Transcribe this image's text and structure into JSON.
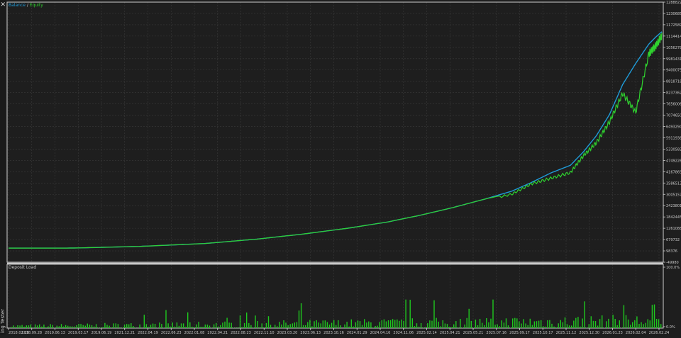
{
  "window": {
    "close_glyph": "✕",
    "side_label": "ing Tester"
  },
  "legend": {
    "balance": "Balance",
    "sep": " / ",
    "equity": "Equity"
  },
  "colors": {
    "background": "#1e1e1e",
    "grid": "#3a3a3a",
    "frame": "#cfcfcf",
    "balance": "#1f9bd8",
    "equity": "#2fd12f",
    "load_bars": "#1ec81e",
    "axis_text": "#c8c8c8"
  },
  "chart_data": [
    {
      "type": "line",
      "series": [
        {
          "name": "Balance",
          "x": [
            0,
            0.1,
            0.2,
            0.3,
            0.38,
            0.45,
            0.52,
            0.58,
            0.63,
            0.68,
            0.73,
            0.77,
            0.8,
            0.83,
            0.86,
            0.88,
            0.9,
            0.92,
            0.94,
            0.96,
            0.98,
            0.99,
            1.0
          ],
          "y": [
            92000,
            96000,
            180000,
            330000,
            560000,
            820000,
            1130000,
            1450000,
            1800000,
            2200000,
            2650000,
            3050000,
            3500000,
            4000000,
            4400000,
            5100000,
            5950000,
            7050000,
            8600000,
            9700000,
            10700000,
            11050000,
            11350000
          ]
        },
        {
          "name": "Equity",
          "x": [
            0,
            0.1,
            0.2,
            0.3,
            0.38,
            0.45,
            0.52,
            0.58,
            0.63,
            0.68,
            0.73,
            0.77,
            0.8,
            0.83,
            0.86,
            0.88,
            0.9,
            0.92,
            0.94,
            0.96,
            0.98,
            0.99,
            1.0
          ],
          "y": [
            92000,
            96000,
            180000,
            330000,
            560000,
            820000,
            1130000,
            1450000,
            1800000,
            2200000,
            2650000,
            2950000,
            3500000,
            3800000,
            4100000,
            5000000,
            5700000,
            6800000,
            8300000,
            7300000,
            10400000,
            10800000,
            11350000
          ]
        }
      ],
      "ylim": [
        -49980,
        12888221
      ],
      "yticks": [
        "12888221",
        "12306855",
        "11725899",
        "11144143",
        "10562787",
        "9981431",
        "9400075",
        "8818718",
        "8237362",
        "7656006",
        "7074650",
        "6493294",
        "5911938",
        "5330582",
        "4749226",
        "4167869",
        "3586513",
        "3005157",
        "2423801",
        "1842445",
        "1261088",
        "679732",
        "98376",
        "-49980"
      ],
      "xticks": [
        "2018.02.28",
        "2018.09.28",
        "2019.06.13",
        "2019.03.17",
        "2019.06.19",
        "2021.12.21",
        "2022.04.19",
        "2022.06.23",
        "2022.01.08",
        "2022.04.21",
        "2022.08.23",
        "2022.11.10",
        "2023.03.20",
        "2023.06.13",
        "2023.10.16",
        "2024.01.29",
        "2024.04.16",
        "2024.11.06",
        "2025.02.14",
        "2025.04.21",
        "2025.05.21",
        "2025.07.16",
        "2025.09.17",
        "2025.10.17",
        "2025.11.12",
        "2025.12.30",
        "2026.01.23",
        "2026.02.04",
        "2026.02.24"
      ]
    },
    {
      "type": "bar",
      "title": "Deposit Load",
      "yticks": [
        "100.0%",
        "0.0%"
      ],
      "ylim": [
        0,
        100
      ],
      "note_values": "bar heights in percent, estimated"
    }
  ]
}
